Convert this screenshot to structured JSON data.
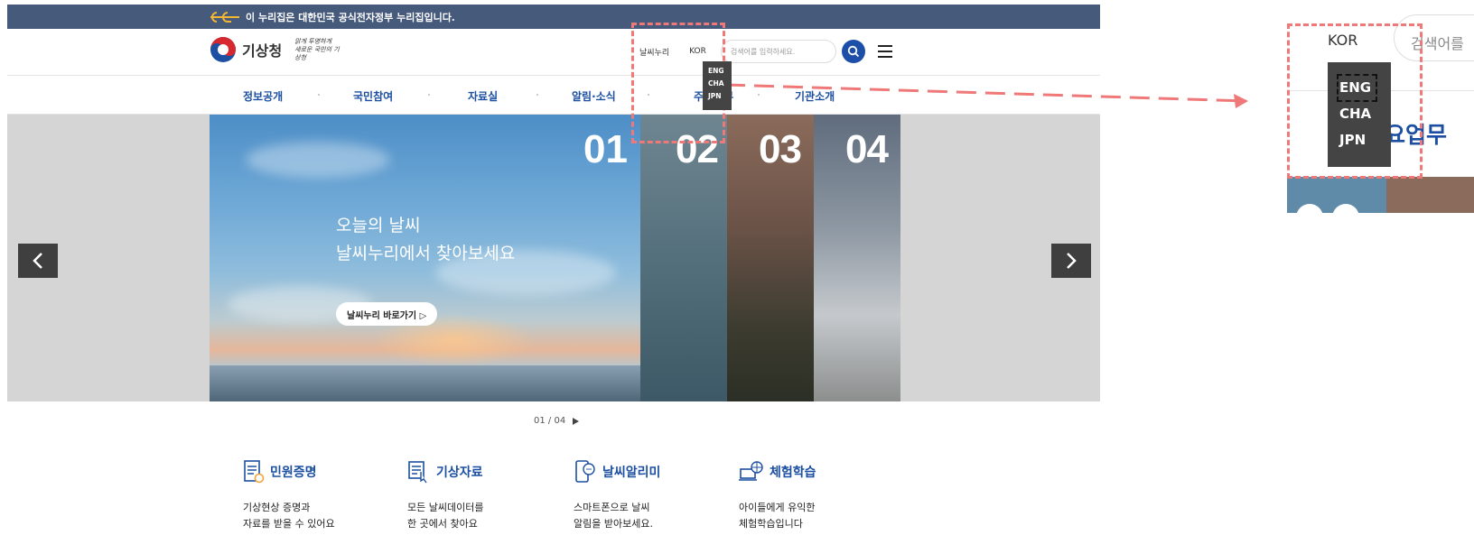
{
  "gov_bar": {
    "text": "이 누리집은 대한민국 공식전자정부 누리집입니다."
  },
  "header": {
    "brand_name": "기상청",
    "slogan_line1": "맑게 투명하게",
    "slogan_line2": "새로운 국민의 기상청",
    "util_link": "날씨누리",
    "lang_current": "KOR",
    "search_placeholder": "검색어를 입력하세요.",
    "lang_options": [
      "ENG",
      "CHA",
      "JPN"
    ]
  },
  "gnb": [
    "정보공개",
    "국민참여",
    "자료실",
    "알림·소식",
    "주요업무",
    "기관소개"
  ],
  "hero": {
    "line1": "오늘의 날씨",
    "line2": "날씨누리에서 찾아보세요",
    "button": "날씨누리 바로가기 ▷",
    "panels": [
      "01",
      "02",
      "03",
      "04"
    ],
    "pager": "01 / 04"
  },
  "quick": [
    {
      "title": "민원증명",
      "desc1": "기상현상 증명과",
      "desc2": "자료를 받을 수 있어요"
    },
    {
      "title": "기상자료",
      "desc1": "모든 날씨데이터를",
      "desc2": "한 곳에서 찾아요"
    },
    {
      "title": "날씨알리미",
      "desc1": "스마트폰으로 날씨",
      "desc2": "알림을 받아보세요."
    },
    {
      "title": "체험학습",
      "desc1": "아이들에게 유익한",
      "desc2": "체험학습입니다"
    }
  ],
  "inset": {
    "lang_current": "KOR",
    "search_fragment": "검색어를",
    "menu_fragment": "주요업무",
    "lang_options": [
      "ENG",
      "CHA",
      "JPN"
    ]
  },
  "colors": {
    "accent": "#1c4fa1",
    "gov_bar": "#465a7c",
    "highlight": "#ef7878"
  }
}
